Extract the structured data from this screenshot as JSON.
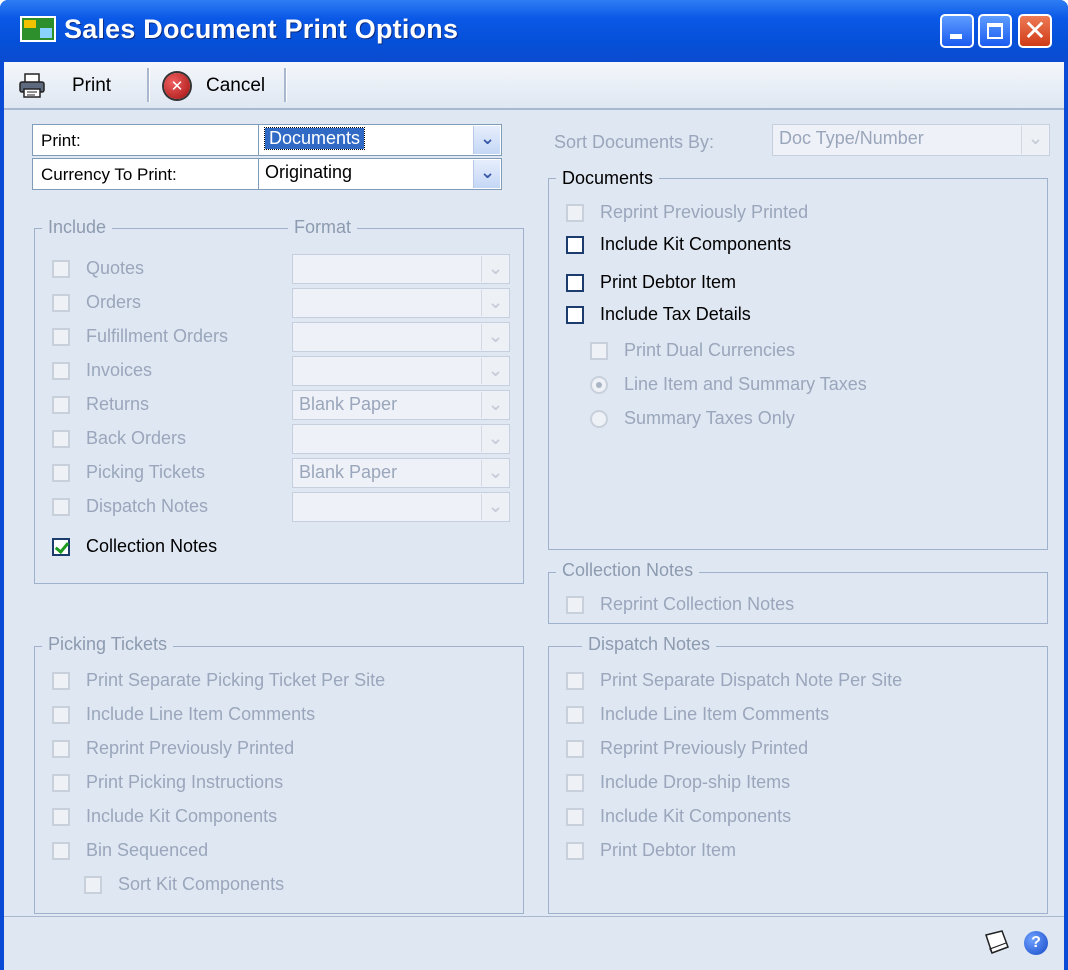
{
  "window": {
    "title": "Sales Document Print Options"
  },
  "toolbar": {
    "print_label": "Print",
    "cancel_label": "Cancel"
  },
  "print_field": {
    "label": "Print:",
    "value": "Documents"
  },
  "currency_field": {
    "label": "Currency To Print:",
    "value": "Originating"
  },
  "sort_field": {
    "label": "Sort Documents By:",
    "value": "Doc Type/Number"
  },
  "include_group": {
    "title": "Include",
    "format_title": "Format",
    "items": [
      {
        "label": "Quotes",
        "checked": false,
        "format": ""
      },
      {
        "label": "Orders",
        "checked": false,
        "format": ""
      },
      {
        "label": "Fulfillment Orders",
        "checked": false,
        "format": ""
      },
      {
        "label": "Invoices",
        "checked": false,
        "format": ""
      },
      {
        "label": "Returns",
        "checked": false,
        "format": "Blank Paper"
      },
      {
        "label": "Back Orders",
        "checked": false,
        "format": ""
      },
      {
        "label": "Picking Tickets",
        "checked": false,
        "format": "Blank Paper"
      },
      {
        "label": "Dispatch Notes",
        "checked": false,
        "format": ""
      },
      {
        "label": "Collection Notes",
        "checked": true
      }
    ]
  },
  "documents_group": {
    "title": "Documents",
    "reprint": "Reprint Previously Printed",
    "kit": "Include Kit Components",
    "debtor": "Print Debtor Item",
    "tax": "Include Tax Details",
    "dual": "Print Dual Currencies",
    "radio_line": "Line Item and Summary Taxes",
    "radio_summary": "Summary Taxes Only"
  },
  "collection_group": {
    "title": "Collection Notes",
    "reprint": "Reprint Collection Notes"
  },
  "picking_group": {
    "title": "Picking Tickets",
    "items": [
      "Print Separate Picking Ticket Per Site",
      "Include Line Item Comments",
      "Reprint Previously Printed",
      "Print Picking Instructions",
      "Include Kit Components",
      "Bin Sequenced"
    ],
    "sort_kit": "Sort Kit Components"
  },
  "dispatch_group": {
    "title": "Dispatch Notes",
    "items": [
      "Print Separate Dispatch Note Per Site",
      "Include Line Item Comments",
      "Reprint Previously Printed",
      "Include Drop-ship Items",
      "Include Kit Components",
      "Print Debtor Item"
    ]
  },
  "help": {
    "help_glyph": "?"
  }
}
